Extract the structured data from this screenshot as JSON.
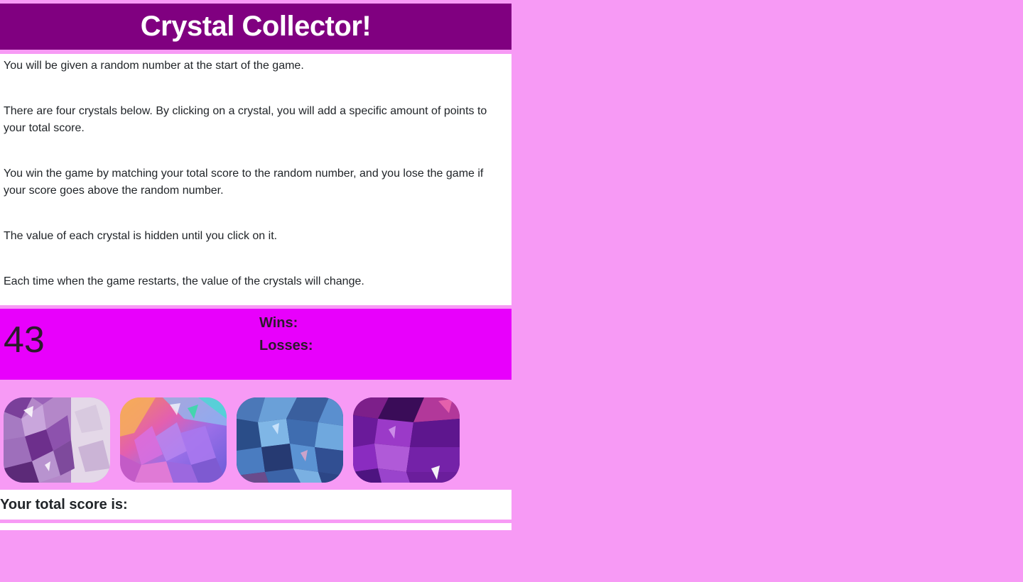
{
  "header": {
    "title": "Crystal Collector!"
  },
  "instructions": [
    "You will be given a random number at the start of the game.",
    "There are four crystals below. By clicking on a crystal, you will add a specific amount of points to your total score.",
    "You win the game by matching your total score to the random number, and you lose the game if your score goes above the random number.",
    "The value of each crystal is hidden until you click on it.",
    "Each time when the game restarts, the value of the crystals will change."
  ],
  "scoreboard": {
    "target_number": "43",
    "wins_label": "Wins:",
    "wins_value": "",
    "losses_label": "Losses:",
    "losses_value": ""
  },
  "crystals": [
    {
      "icon": "amethyst-crystal-icon",
      "color": "#a36fc2"
    },
    {
      "icon": "rainbow-crystal-icon",
      "color": "#c77de0"
    },
    {
      "icon": "blue-crystal-icon",
      "color": "#3f6fa6"
    },
    {
      "icon": "purple-crystal-icon",
      "color": "#7a1aa0"
    }
  ],
  "total": {
    "label": "Your total score is:",
    "value": ""
  },
  "colors": {
    "background": "#f79af5",
    "header": "#800080",
    "score_panel": "#e800fc"
  }
}
